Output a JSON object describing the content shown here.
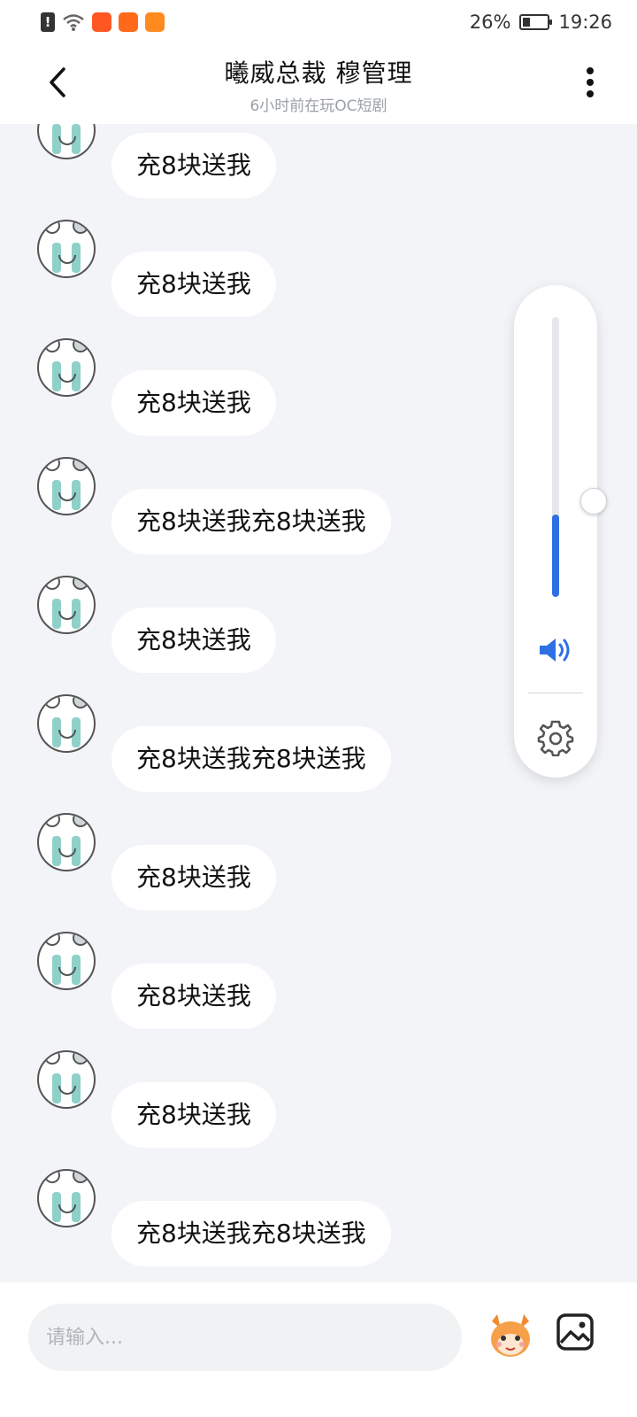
{
  "status_bar": {
    "battery": "26%",
    "time": "19:26"
  },
  "header": {
    "title": "曦威总裁  穆管理",
    "subtitle": "6小时前在玩OC短剧"
  },
  "messages": [
    {
      "text": "充8块送我"
    },
    {
      "text": "充8块送我"
    },
    {
      "text": "充8块送我"
    },
    {
      "text": "充8块送我充8块送我"
    },
    {
      "text": "充8块送我"
    },
    {
      "text": "充8块送我充8块送我"
    },
    {
      "text": "充8块送我"
    },
    {
      "text": "充8块送我"
    },
    {
      "text": "充8块送我"
    },
    {
      "text": "充8块送我充8块送我"
    }
  ],
  "volume": {
    "level": 0.34
  },
  "input": {
    "placeholder": "请输入..."
  },
  "colors": {
    "accent": "#2f6fe4",
    "background": "#f2f4f7"
  }
}
